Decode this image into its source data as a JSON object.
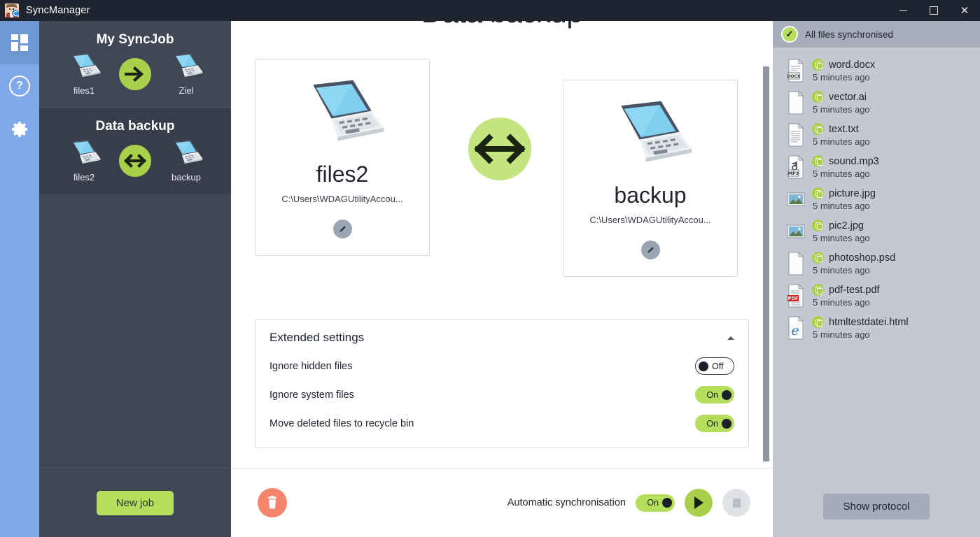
{
  "window": {
    "title": "SyncManager",
    "app_icon": "sync-person-icon",
    "controls": {
      "minimize": "minimize-icon",
      "maximize": "maximize-icon",
      "close": "close-icon"
    }
  },
  "rail": {
    "items": [
      {
        "icon": "dashboard-grid-icon",
        "name": "dashboard",
        "active": true
      },
      {
        "icon": "help-question-icon",
        "name": "help",
        "active": false
      },
      {
        "icon": "gear-settings-icon",
        "name": "settings",
        "active": false
      }
    ]
  },
  "sidebar": {
    "jobs": [
      {
        "title": "My SyncJob",
        "source": "files1",
        "target": "Ziel",
        "direction": "one-way-right",
        "selected": false
      },
      {
        "title": "Data backup",
        "source": "files2",
        "target": "backup",
        "direction": "two-way",
        "selected": true
      }
    ],
    "new_job_label": "New job"
  },
  "main": {
    "heading": "Data backup",
    "direction_icon": "two-way-arrow-icon",
    "left_card": {
      "name": "files2",
      "path": "C:\\Users\\WDAGUtilityAccou...",
      "illustration": "laptop-icon",
      "edit_icon": "pencil-icon"
    },
    "right_card": {
      "name": "backup",
      "path": "C:\\Users\\WDAGUtilityAccou...",
      "illustration": "laptop-icon",
      "edit_icon": "pencil-icon"
    },
    "settings": {
      "title": "Extended settings",
      "collapse_icon": "caret-up-icon",
      "rows": [
        {
          "label": "Ignore hidden files",
          "state": "Off",
          "on": false
        },
        {
          "label": "Ignore system files",
          "state": "On",
          "on": true
        },
        {
          "label": "Move deleted files to recycle bin",
          "state": "On",
          "on": true
        }
      ]
    },
    "footer": {
      "delete_icon": "trash-icon",
      "autosync_label": "Automatic synchronisation",
      "autosync_state": "On",
      "play_icon": "play-icon",
      "stop_icon": "stop-icon"
    }
  },
  "rightpanel": {
    "status": {
      "text": "All files synchronised",
      "icon": "check-circle-icon"
    },
    "files": [
      {
        "name": "word.docx",
        "time": "5 minutes ago",
        "icon": "docx-file-icon",
        "badge": "sync-badge-icon"
      },
      {
        "name": "vector.ai",
        "time": "5 minutes ago",
        "icon": "blank-file-icon",
        "badge": "sync-badge-icon"
      },
      {
        "name": "text.txt",
        "time": "5 minutes ago",
        "icon": "text-file-icon",
        "badge": "sync-badge-icon"
      },
      {
        "name": "sound.mp3",
        "time": "5 minutes ago",
        "icon": "mp3-file-icon",
        "badge": "sync-badge-icon"
      },
      {
        "name": "picture.jpg",
        "time": "5 minutes ago",
        "icon": "image-file-icon",
        "badge": "sync-badge-icon"
      },
      {
        "name": "pic2.jpg",
        "time": "5 minutes ago",
        "icon": "image-file-icon",
        "badge": "sync-badge-icon"
      },
      {
        "name": "photoshop.psd",
        "time": "5 minutes ago",
        "icon": "blank-file-icon",
        "badge": "sync-badge-icon"
      },
      {
        "name": "pdf-test.pdf",
        "time": "5 minutes ago",
        "icon": "pdf-file-icon",
        "badge": "sync-badge-icon"
      },
      {
        "name": "htmltestdatei.html",
        "time": "5 minutes ago",
        "icon": "html-file-icon",
        "badge": "sync-badge-icon"
      }
    ],
    "show_protocol_label": "Show protocol"
  },
  "colors": {
    "titlebar": "#1e2430",
    "rail": "#7fa9e8",
    "rail_active": "#6e97d4",
    "sidebar": "#3f4655",
    "sidebar_alt": "#373d4b",
    "accent_green": "#a8d04a",
    "accent_green_light": "#b4de5b",
    "arrow_circle": "#c3e47e",
    "panel_bg": "#c3c8d2",
    "status_bg": "#a7aeba",
    "delete_red": "#f4846b",
    "pdf_red": "#d41e1e"
  }
}
